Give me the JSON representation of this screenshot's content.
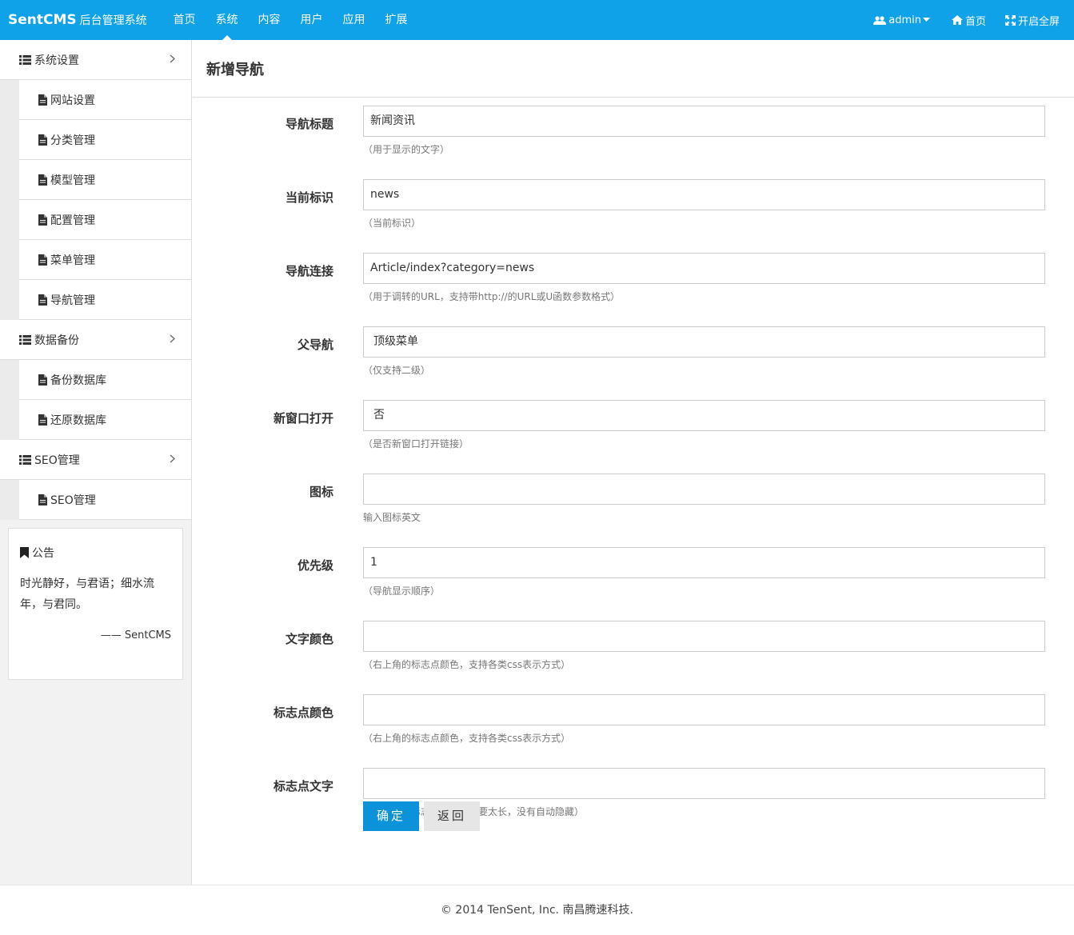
{
  "header": {
    "brand": "SentCMS",
    "brand_sub": "后台管理系统",
    "nav": [
      "首页",
      "系统",
      "内容",
      "用户",
      "应用",
      "扩展"
    ],
    "active_nav": "系统",
    "user": "admin",
    "home": "首页",
    "fullscreen": "开启全屏"
  },
  "sidebar": {
    "groups": [
      {
        "title": "系统设置",
        "items": [
          "网站设置",
          "分类管理",
          "模型管理",
          "配置管理",
          "菜单管理",
          "导航管理"
        ]
      },
      {
        "title": "数据备份",
        "items": [
          "备份数据库",
          "还原数据库"
        ]
      },
      {
        "title": "SEO管理",
        "items": [
          "SEO管理"
        ]
      }
    ],
    "notice": {
      "title": "公告",
      "text": "时光静好，与君语；细水流年，与君同。",
      "signature": "—— SentCMS"
    }
  },
  "main": {
    "title": "新增导航",
    "fields": [
      {
        "label": "导航标题",
        "value": "新闻资讯",
        "help": "（用于显示的文字）"
      },
      {
        "label": "当前标识",
        "value": "news",
        "help": "（当前标识）"
      },
      {
        "label": "导航连接",
        "value": "Article/index?category=news",
        "help": "（用于调转的URL，支持带http://的URL或U函数参数格式）"
      },
      {
        "label": "父导航",
        "value": "顶级菜单",
        "help": "（仅支持二级）"
      },
      {
        "label": "新窗口打开",
        "value": "否",
        "help": "（是否新窗口打开链接）"
      },
      {
        "label": "图标",
        "value": "",
        "help": "输入图标英文"
      },
      {
        "label": "优先级",
        "value": "1",
        "help": "（导航显示顺序）"
      },
      {
        "label": "文字颜色",
        "value": "",
        "help": "（右上角的标志点颜色，支持各类css表示方式）"
      },
      {
        "label": "标志点颜色",
        "value": "",
        "help": "（右上角的标志点颜色，支持各类css表示方式）"
      },
      {
        "label": "标志点文字",
        "value": "",
        "help": "（右上角的标志点文字，不要太长，没有自动隐藏）"
      }
    ],
    "submit": "确定",
    "back": "返回"
  },
  "footer": "© 2014 TenSent, Inc. 南昌腾速科技.",
  "colors": {
    "primary": "#0fa2e8",
    "button": "#0b92d9"
  }
}
